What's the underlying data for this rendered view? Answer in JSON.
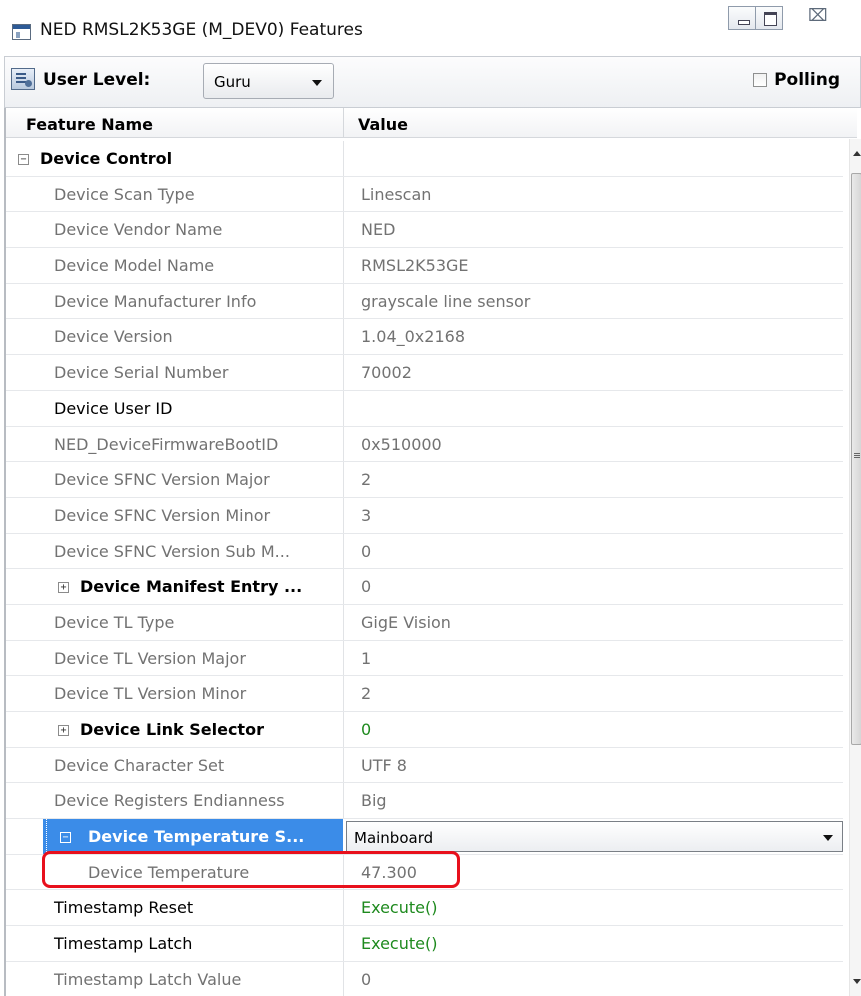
{
  "window": {
    "title": "NED RMSL2K53GE (M_DEV0) Features",
    "close_glyph": "⌧"
  },
  "toolbar": {
    "user_level_label": "User Level:",
    "user_level_value": "Guru",
    "polling_label": "Polling",
    "polling_checked": false
  },
  "grid": {
    "headers": {
      "name": "Feature Name",
      "value": "Value"
    },
    "rows": [
      {
        "name": "Device Control",
        "value": ""
      },
      {
        "name": "Device Scan Type",
        "value": "Linescan"
      },
      {
        "name": "Device Vendor Name",
        "value": "NED"
      },
      {
        "name": "Device Model Name",
        "value": "RMSL2K53GE"
      },
      {
        "name": "Device Manufacturer Info",
        "value": "grayscale line sensor"
      },
      {
        "name": "Device Version",
        "value": "1.04_0x2168"
      },
      {
        "name": "Device Serial Number",
        "value": "70002"
      },
      {
        "name": "Device User ID",
        "value": ""
      },
      {
        "name": "NED_DeviceFirmwareBootID",
        "value": "0x510000"
      },
      {
        "name": "Device SFNC Version Major",
        "value": "2"
      },
      {
        "name": "Device SFNC Version Minor",
        "value": "3"
      },
      {
        "name": "Device SFNC Version Sub M...",
        "value": "0"
      },
      {
        "name": "Device Manifest Entry ...",
        "value": "0"
      },
      {
        "name": "Device TL Type",
        "value": "GigE Vision"
      },
      {
        "name": "Device TL Version Major",
        "value": "1"
      },
      {
        "name": "Device TL Version Minor",
        "value": "2"
      },
      {
        "name": "Device Link Selector",
        "value": "0"
      },
      {
        "name": "Device Character Set",
        "value": "UTF 8"
      },
      {
        "name": "Device Registers Endianness",
        "value": "Big"
      },
      {
        "name": "Device Temperature S...",
        "value": "Mainboard"
      },
      {
        "name": "Device Temperature",
        "value": "47.300"
      },
      {
        "name": "Timestamp Reset",
        "value": "Execute()"
      },
      {
        "name": "Timestamp Latch",
        "value": "Execute()"
      },
      {
        "name": "Timestamp Latch Value",
        "value": "0"
      }
    ]
  },
  "colors": {
    "selection": "#3b8ce8",
    "highlight_box": "#e8101c",
    "readonly_text": "#727272",
    "command_text": "#1e8a1e"
  }
}
